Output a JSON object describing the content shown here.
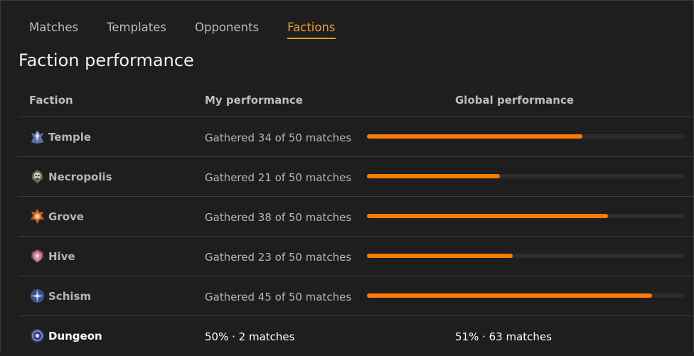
{
  "tabs": [
    {
      "label": "Matches",
      "active": false
    },
    {
      "label": "Templates",
      "active": false
    },
    {
      "label": "Opponents",
      "active": false
    },
    {
      "label": "Factions",
      "active": true
    }
  ],
  "page_title": "Faction performance",
  "table": {
    "headers": {
      "faction": "Faction",
      "my_performance": "My performance",
      "global_performance": "Global performance"
    },
    "rows": [
      {
        "faction": "Temple",
        "icon": "temple-emblem-icon",
        "gathered": "Gathered 34 of 50 matches",
        "progress": 0.68
      },
      {
        "faction": "Necropolis",
        "icon": "necropolis-emblem-icon",
        "gathered": "Gathered 21 of 50 matches",
        "progress": 0.42
      },
      {
        "faction": "Grove",
        "icon": "grove-emblem-icon",
        "gathered": "Gathered 38 of 50 matches",
        "progress": 0.76
      },
      {
        "faction": "Hive",
        "icon": "hive-emblem-icon",
        "gathered": "Gathered 23 of 50 matches",
        "progress": 0.46
      },
      {
        "faction": "Schism",
        "icon": "schism-emblem-icon",
        "gathered": "Gathered 45 of 50 matches",
        "progress": 0.9
      }
    ],
    "summary": {
      "faction": "Dungeon",
      "icon": "dungeon-emblem-icon",
      "my_performance": "50% · 2 matches",
      "global_performance": "51% · 63 matches"
    }
  },
  "colors": {
    "accent": "#f29a2e",
    "bar_fill": "#ff7b00",
    "bar_track": "#2d2d2d",
    "background": "#1e1e1e"
  }
}
